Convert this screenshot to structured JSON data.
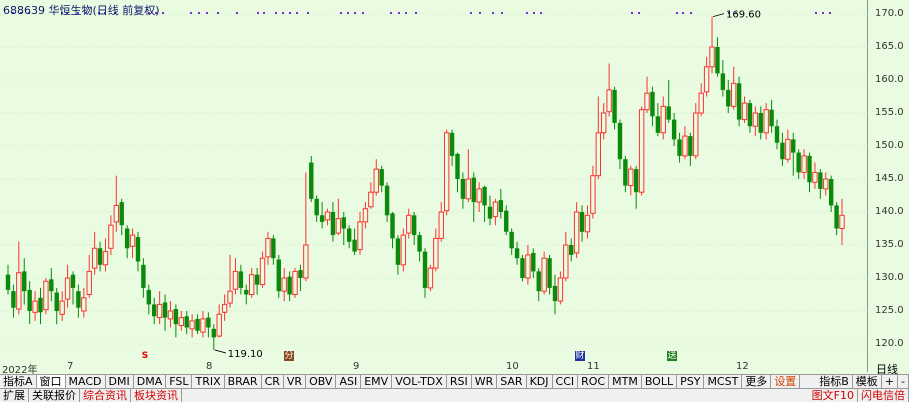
{
  "title": "688639 华恒生物(日线 前复权)",
  "price_labels": [
    "170.0",
    "165.0",
    "160.0",
    "155.0",
    "150.0",
    "145.0",
    "140.0",
    "135.0",
    "130.0",
    "125.0",
    "120.0"
  ],
  "high_label": "169.60",
  "low_label": "119.10",
  "dates": {
    "start": "2022年",
    "m7": "7",
    "m8": "8",
    "m9": "9",
    "m10": "10",
    "m11": "11",
    "m12": "12"
  },
  "period": "日线",
  "markers": {
    "s": "S",
    "box1": "分",
    "box2": "财",
    "box3": "送"
  },
  "tabs": [
    "指标A",
    "窗口",
    "MACD",
    "DMI",
    "DMA",
    "FSL",
    "TRIX",
    "BRAR",
    "CR",
    "VR",
    "OBV",
    "ASI",
    "EMV",
    "VOL-TDX",
    "RSI",
    "WR",
    "SAR",
    "KDJ",
    "CCI",
    "ROC",
    "MTM",
    "BOLL",
    "PSY",
    "MCST",
    "更多",
    "设置"
  ],
  "tabs_right": [
    "指标B",
    "模板",
    "+",
    "-"
  ],
  "bottom_tabs": [
    "扩展",
    "关联报价",
    "综合资讯",
    "板块资讯"
  ],
  "bottom_right": [
    "图文F10",
    "闪电信倍"
  ],
  "colors": {
    "up": "#ff3232",
    "down": "#0a8a0a",
    "bg": "#e9fbe0",
    "grid": "#b7d9b0"
  },
  "chart_data": {
    "type": "candlestick",
    "ylim": [
      118,
      172
    ],
    "candles": [
      [
        130.5,
        128.2,
        132.0,
        127.5
      ],
      [
        128.0,
        125.5,
        129.0,
        124.0
      ],
      [
        125.3,
        130.8,
        135.5,
        124.5
      ],
      [
        131.0,
        128.0,
        133.0,
        126.0
      ],
      [
        128.2,
        125.0,
        129.5,
        123.0
      ],
      [
        124.8,
        126.5,
        128.0,
        123.5
      ],
      [
        127.0,
        124.8,
        128.5,
        123.0
      ],
      [
        125.2,
        129.5,
        130.0,
        124.5
      ],
      [
        129.8,
        128.0,
        131.5,
        126.5
      ],
      [
        127.8,
        125.0,
        128.5,
        123.0
      ],
      [
        124.5,
        126.5,
        128.0,
        123.5
      ],
      [
        126.8,
        130.0,
        132.0,
        125.5
      ],
      [
        130.5,
        128.5,
        131.0,
        126.0
      ],
      [
        128.0,
        125.5,
        129.0,
        124.0
      ],
      [
        125.0,
        127.0,
        128.5,
        124.0
      ],
      [
        127.5,
        131.0,
        133.5,
        127.0
      ],
      [
        131.5,
        134.5,
        137.0,
        130.5
      ],
      [
        134.5,
        132.0,
        135.5,
        131.0
      ],
      [
        132.0,
        134.0,
        136.0,
        131.0
      ],
      [
        134.5,
        138.0,
        139.5,
        133.5
      ],
      [
        138.5,
        141.0,
        145.5,
        137.0
      ],
      [
        141.5,
        138.0,
        142.0,
        136.5
      ],
      [
        137.5,
        134.5,
        138.0,
        133.0
      ],
      [
        134.8,
        136.5,
        137.5,
        133.0
      ],
      [
        136.2,
        132.5,
        137.0,
        131.0
      ],
      [
        132.0,
        128.5,
        133.0,
        127.0
      ],
      [
        128.2,
        126.0,
        129.0,
        124.5
      ],
      [
        126.0,
        124.2,
        127.0,
        123.0
      ],
      [
        124.0,
        126.0,
        128.0,
        123.0
      ],
      [
        126.3,
        124.0,
        127.5,
        122.0
      ],
      [
        123.8,
        125.0,
        126.5,
        122.5
      ],
      [
        125.3,
        123.0,
        126.0,
        121.0
      ],
      [
        122.8,
        124.0,
        125.0,
        122.0
      ],
      [
        124.2,
        122.5,
        125.0,
        121.5
      ],
      [
        122.3,
        123.5,
        124.5,
        121.0
      ],
      [
        123.8,
        122.0,
        124.5,
        121.5
      ],
      [
        121.8,
        123.8,
        125.0,
        121.0
      ],
      [
        124.0,
        122.5,
        124.8,
        121.0
      ],
      [
        122.3,
        121.0,
        123.0,
        119.1
      ],
      [
        121.2,
        124.5,
        126.0,
        121.0
      ],
      [
        124.8,
        126.0,
        127.5,
        123.5
      ],
      [
        126.2,
        128.0,
        133.5,
        125.5
      ],
      [
        128.3,
        131.0,
        133.0,
        127.5
      ],
      [
        131.0,
        128.5,
        132.0,
        127.5
      ],
      [
        128.2,
        127.5,
        129.0,
        126.0
      ],
      [
        127.5,
        130.5,
        131.5,
        127.0
      ],
      [
        130.5,
        129.0,
        131.5,
        127.5
      ],
      [
        129.0,
        133.0,
        134.0,
        128.5
      ],
      [
        133.2,
        136.0,
        137.0,
        132.0
      ],
      [
        136.0,
        133.0,
        136.5,
        132.0
      ],
      [
        132.8,
        128.0,
        133.5,
        127.0
      ],
      [
        128.0,
        130.0,
        131.5,
        126.5
      ],
      [
        130.2,
        127.5,
        131.0,
        126.5
      ],
      [
        127.5,
        131.0,
        131.5,
        127.0
      ],
      [
        131.2,
        130.0,
        132.0,
        128.0
      ],
      [
        130.0,
        135.0,
        146.0,
        129.5
      ],
      [
        147.5,
        142.0,
        148.5,
        141.5
      ],
      [
        142.0,
        139.5,
        142.5,
        138.5
      ],
      [
        139.5,
        138.5,
        141.5,
        137.5
      ],
      [
        138.8,
        140.0,
        140.5,
        138.0
      ],
      [
        140.0,
        136.5,
        141.5,
        135.5
      ],
      [
        136.8,
        139.0,
        142.0,
        136.5
      ],
      [
        139.2,
        137.5,
        140.0,
        135.0
      ],
      [
        137.5,
        135.5,
        138.0,
        134.5
      ],
      [
        135.8,
        134.0,
        137.5,
        133.5
      ],
      [
        134.3,
        138.5,
        140.0,
        133.5
      ],
      [
        138.5,
        140.5,
        141.5,
        137.5
      ],
      [
        140.8,
        143.0,
        144.5,
        140.5
      ],
      [
        143.0,
        146.5,
        148.0,
        142.5
      ],
      [
        146.5,
        144.0,
        147.0,
        143.0
      ],
      [
        144.0,
        139.5,
        144.5,
        138.5
      ],
      [
        139.8,
        136.0,
        140.0,
        134.5
      ],
      [
        136.0,
        132.0,
        136.5,
        130.5
      ],
      [
        132.0,
        136.5,
        137.5,
        131.0
      ],
      [
        136.8,
        139.5,
        140.5,
        136.0
      ],
      [
        139.5,
        136.5,
        140.0,
        135.0
      ],
      [
        136.5,
        134.0,
        137.0,
        132.5
      ],
      [
        134.0,
        128.5,
        134.5,
        127.0
      ],
      [
        128.5,
        131.5,
        132.0,
        128.0
      ],
      [
        131.5,
        136.0,
        137.5,
        131.0
      ],
      [
        136.0,
        140.0,
        141.5,
        135.5
      ],
      [
        140.2,
        152.0,
        152.5,
        139.5
      ],
      [
        152.0,
        148.5,
        152.5,
        147.0
      ],
      [
        148.8,
        145.0,
        149.0,
        143.0
      ],
      [
        145.0,
        142.0,
        146.0,
        140.5
      ],
      [
        142.0,
        145.0,
        149.5,
        141.5
      ],
      [
        145.2,
        141.5,
        146.0,
        138.5
      ],
      [
        141.5,
        143.5,
        144.5,
        140.0
      ],
      [
        143.8,
        141.0,
        144.0,
        138.5
      ],
      [
        140.8,
        139.0,
        142.5,
        138.0
      ],
      [
        139.3,
        141.5,
        142.0,
        138.0
      ],
      [
        141.8,
        140.0,
        143.5,
        139.0
      ],
      [
        140.2,
        137.0,
        141.0,
        136.5
      ],
      [
        137.0,
        134.5,
        137.5,
        133.5
      ],
      [
        134.5,
        133.0,
        135.5,
        132.0
      ],
      [
        133.0,
        130.0,
        133.5,
        129.5
      ],
      [
        130.0,
        133.5,
        135.0,
        129.0
      ],
      [
        133.8,
        131.0,
        134.5,
        130.0
      ],
      [
        131.0,
        128.0,
        131.5,
        126.5
      ],
      [
        128.0,
        133.0,
        134.0,
        127.5
      ],
      [
        133.0,
        128.5,
        133.5,
        127.5
      ],
      [
        128.8,
        126.5,
        130.5,
        124.5
      ],
      [
        126.5,
        130.0,
        131.0,
        126.0
      ],
      [
        130.0,
        135.0,
        137.0,
        129.5
      ],
      [
        135.0,
        133.5,
        136.0,
        132.5
      ],
      [
        133.8,
        140.0,
        141.5,
        133.0
      ],
      [
        140.0,
        137.0,
        141.0,
        135.5
      ],
      [
        137.0,
        139.5,
        141.0,
        136.0
      ],
      [
        139.8,
        145.5,
        147.0,
        139.0
      ],
      [
        145.5,
        152.0,
        157.5,
        145.0
      ],
      [
        152.0,
        155.0,
        156.5,
        151.0
      ],
      [
        155.2,
        158.5,
        162.5,
        154.5
      ],
      [
        158.5,
        153.5,
        159.0,
        152.5
      ],
      [
        153.5,
        148.0,
        154.0,
        146.5
      ],
      [
        148.0,
        144.0,
        148.5,
        143.0
      ],
      [
        144.0,
        146.5,
        147.0,
        142.5
      ],
      [
        146.5,
        143.0,
        147.0,
        140.5
      ],
      [
        143.0,
        155.5,
        156.0,
        142.5
      ],
      [
        155.5,
        158.0,
        160.5,
        155.0
      ],
      [
        158.2,
        154.5,
        159.0,
        153.0
      ],
      [
        154.5,
        152.0,
        156.5,
        151.5
      ],
      [
        152.0,
        156.0,
        157.5,
        151.0
      ],
      [
        156.0,
        154.0,
        160.0,
        153.5
      ],
      [
        154.0,
        151.0,
        155.0,
        150.0
      ],
      [
        151.0,
        148.5,
        152.0,
        147.5
      ],
      [
        148.5,
        151.5,
        153.0,
        148.0
      ],
      [
        151.5,
        148.5,
        152.0,
        147.0
      ],
      [
        148.5,
        155.0,
        156.5,
        148.0
      ],
      [
        155.0,
        158.0,
        159.5,
        154.5
      ],
      [
        158.2,
        162.0,
        163.5,
        157.5
      ],
      [
        162.0,
        165.0,
        169.6,
        161.0
      ],
      [
        165.0,
        161.0,
        166.5,
        160.5
      ],
      [
        161.0,
        158.5,
        163.0,
        157.5
      ],
      [
        158.5,
        156.0,
        160.0,
        155.0
      ],
      [
        156.0,
        159.5,
        162.0,
        155.5
      ],
      [
        159.5,
        154.0,
        160.5,
        153.0
      ],
      [
        154.0,
        156.5,
        157.5,
        153.5
      ],
      [
        156.5,
        153.0,
        157.0,
        152.0
      ],
      [
        153.0,
        155.0,
        156.0,
        151.5
      ],
      [
        155.0,
        152.0,
        156.0,
        151.0
      ],
      [
        152.0,
        155.5,
        156.5,
        151.0
      ],
      [
        155.5,
        153.0,
        157.0,
        152.0
      ],
      [
        153.0,
        150.5,
        154.0,
        149.5
      ],
      [
        150.5,
        148.0,
        152.0,
        147.0
      ],
      [
        148.0,
        151.0,
        152.5,
        147.5
      ],
      [
        151.0,
        149.0,
        152.0,
        145.5
      ],
      [
        149.0,
        146.0,
        149.5,
        145.0
      ],
      [
        146.0,
        148.5,
        149.5,
        145.0
      ],
      [
        148.5,
        144.5,
        149.0,
        143.0
      ],
      [
        144.5,
        146.0,
        147.5,
        143.5
      ],
      [
        146.0,
        143.5,
        146.5,
        142.0
      ],
      [
        143.5,
        145.0,
        146.0,
        142.5
      ],
      [
        145.0,
        141.0,
        145.5,
        140.0
      ],
      [
        141.0,
        137.5,
        141.5,
        136.5
      ],
      [
        137.5,
        139.5,
        142.0,
        135.0
      ]
    ]
  }
}
